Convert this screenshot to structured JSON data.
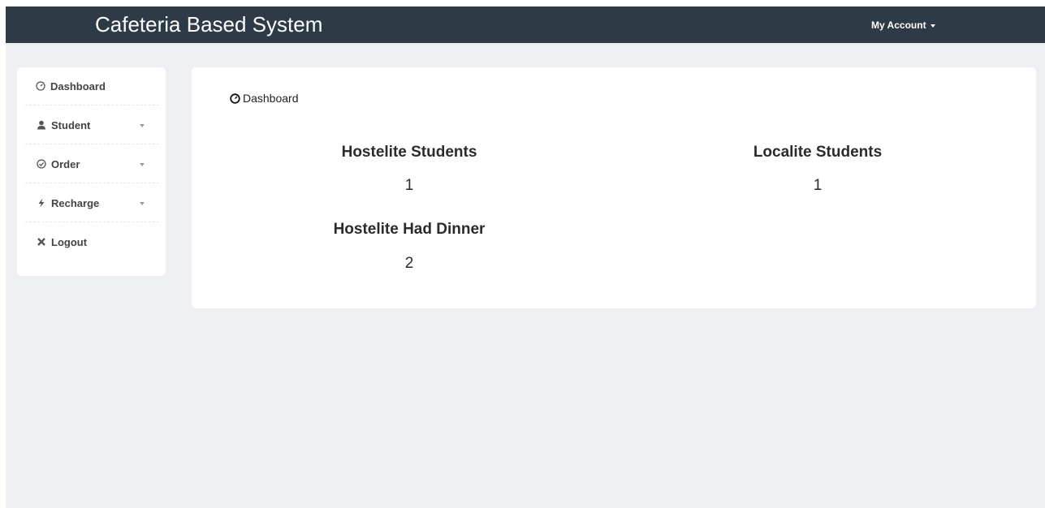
{
  "navbar": {
    "brand": "Cafeteria Based System",
    "account_label": "My Account"
  },
  "sidebar": {
    "items": [
      {
        "label": "Dashboard",
        "icon": "dashboard-icon"
      },
      {
        "label": "Student",
        "icon": "user-icon"
      },
      {
        "label": "Order",
        "icon": "check-circle-icon"
      },
      {
        "label": "Recharge",
        "icon": "flash-icon"
      },
      {
        "label": "Logout",
        "icon": "close-icon"
      }
    ]
  },
  "main": {
    "breadcrumb": "Dashboard",
    "stats": [
      {
        "title": "Hostelite Students",
        "value": "1"
      },
      {
        "title": "Localite Students",
        "value": "1"
      },
      {
        "title": "Hostelite Had Dinner",
        "value": "2"
      }
    ]
  },
  "colors": {
    "navbar_bg": "#2e3a46",
    "page_bg": "#eeeff3",
    "card_bg": "#ffffff"
  }
}
